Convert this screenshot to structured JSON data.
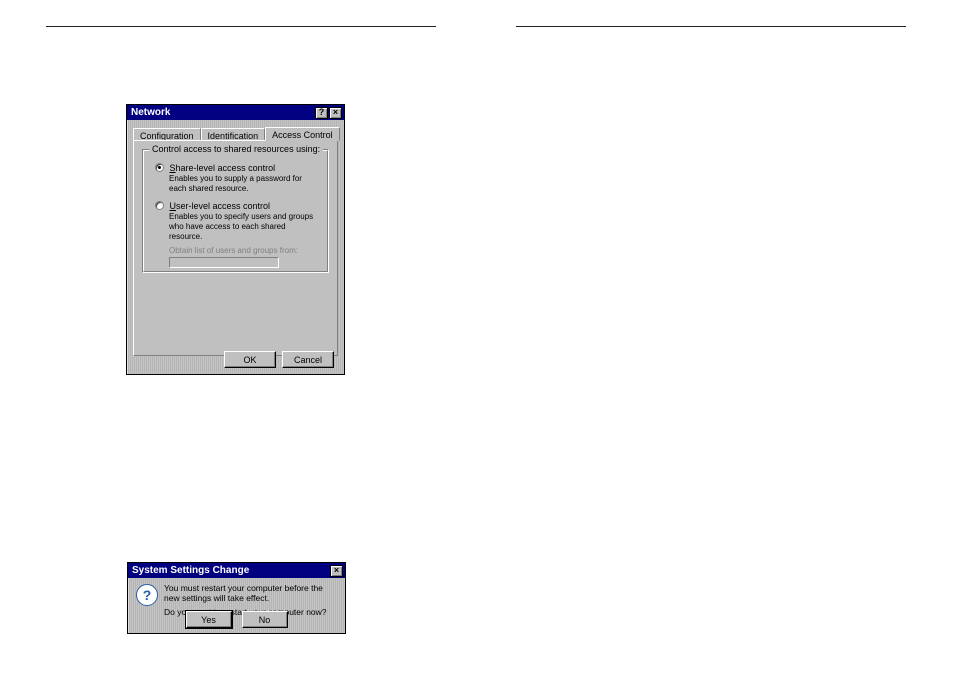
{
  "network_dialog": {
    "title": "Network",
    "help_btn": "?",
    "close_btn": "×",
    "tabs": {
      "configuration": "Configuration",
      "identification": "Identification",
      "access_control": "Access Control"
    },
    "group_label": "Control access to shared resources using:",
    "share_level": {
      "label_prefix": "S",
      "label_rest": "hare-level access control",
      "hint": "Enables you to supply a password for each shared resource."
    },
    "user_level": {
      "label_prefix": "U",
      "label_rest": "ser-level access control",
      "hint": "Enables you to specify users and groups who have access to each shared resource.",
      "obtain_label": "Obtain list of users and groups from:"
    },
    "ok_label": "OK",
    "cancel_label": "Cancel"
  },
  "restart_dialog": {
    "title": "System Settings Change",
    "close_btn": "×",
    "icon_glyph": "?",
    "message1": "You must restart your computer before the new settings will take effect.",
    "message2": "Do you want to restart your computer now?",
    "yes_label": "Yes",
    "no_label": "No"
  }
}
